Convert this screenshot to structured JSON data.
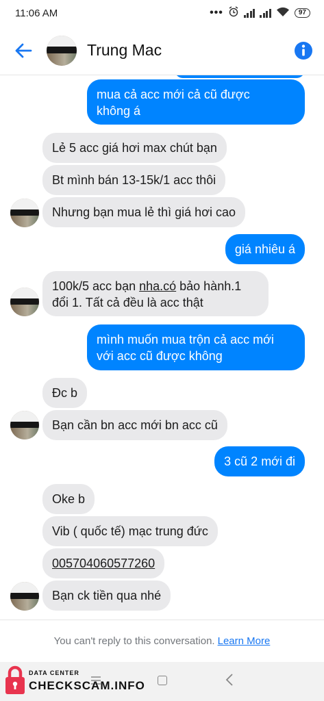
{
  "status_bar": {
    "time": "11:06 AM",
    "battery": "97"
  },
  "header": {
    "title": "Trung Mac"
  },
  "messages": [
    {
      "dir": "in",
      "text": "Lẻ 5 acc giá hơi max chút bạn"
    },
    {
      "dir": "in",
      "text": "Bt mình bán 13-15k/1 acc thôi"
    },
    {
      "dir": "in",
      "text": "Nhưng bạn mua lẻ thì giá hơi cao"
    },
    {
      "dir": "out",
      "text": "giá nhiêu á"
    },
    {
      "dir": "in",
      "text_a": "100k/5 acc bạn ",
      "text_link": "nha.có",
      "text_b": " bảo hành.1",
      "line2": "đổi 1. Tất cả đều là acc thật"
    },
    {
      "dir": "out",
      "line1": "mình muốn mua trộn cả acc mới",
      "line2": "với acc cũ được không"
    },
    {
      "dir": "in",
      "text": "Đc b"
    },
    {
      "dir": "in",
      "text": "Bạn cần bn acc mới bn acc cũ"
    },
    {
      "dir": "out",
      "text": "3 cũ 2 mới đi"
    },
    {
      "dir": "in",
      "text": "Oke b"
    },
    {
      "dir": "in",
      "text": "Vib ( quốc tế) mạc trung đức"
    },
    {
      "dir": "in",
      "text": "005704060577260"
    },
    {
      "dir": "in",
      "text": "Bạn ck tiền qua  nhé"
    }
  ],
  "top_out": {
    "line1": "mua cả acc mới cả cũ được",
    "line2": "không á"
  },
  "notice": {
    "text": "You can't reply to this conversation.",
    "link": "Learn More"
  },
  "watermark": {
    "small": "DATA CENTER",
    "big": "CHECKSCAM.INFO"
  },
  "colors": {
    "accent": "#0084ff",
    "incoming": "#e9e9eb",
    "link": "#1877f2"
  }
}
